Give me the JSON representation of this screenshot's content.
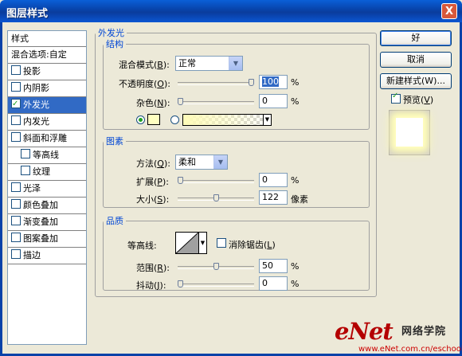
{
  "window": {
    "title": "图层样式",
    "close_glyph": "X"
  },
  "style_list": {
    "header": "样式",
    "items": [
      {
        "label": "混合选项:自定",
        "checkbox": false,
        "checked": false,
        "selected": false,
        "indent": false
      },
      {
        "label": "投影",
        "checkbox": true,
        "checked": false,
        "selected": false,
        "indent": false
      },
      {
        "label": "内阴影",
        "checkbox": true,
        "checked": false,
        "selected": false,
        "indent": false
      },
      {
        "label": "外发光",
        "checkbox": true,
        "checked": true,
        "selected": true,
        "indent": false
      },
      {
        "label": "内发光",
        "checkbox": true,
        "checked": false,
        "selected": false,
        "indent": false
      },
      {
        "label": "斜面和浮雕",
        "checkbox": true,
        "checked": false,
        "selected": false,
        "indent": false
      },
      {
        "label": "等高线",
        "checkbox": true,
        "checked": false,
        "selected": false,
        "indent": true
      },
      {
        "label": "纹理",
        "checkbox": true,
        "checked": false,
        "selected": false,
        "indent": true
      },
      {
        "label": "光泽",
        "checkbox": true,
        "checked": false,
        "selected": false,
        "indent": false
      },
      {
        "label": "颜色叠加",
        "checkbox": true,
        "checked": false,
        "selected": false,
        "indent": false
      },
      {
        "label": "渐变叠加",
        "checkbox": true,
        "checked": false,
        "selected": false,
        "indent": false
      },
      {
        "label": "图案叠加",
        "checkbox": true,
        "checked": false,
        "selected": false,
        "indent": false
      },
      {
        "label": "描边",
        "checkbox": true,
        "checked": false,
        "selected": false,
        "indent": false
      }
    ]
  },
  "outer_glow": {
    "section_title": "外发光",
    "structure": {
      "title": "结构",
      "blend_mode": {
        "label": "混合模式(",
        "key": "B",
        "label_end": "):",
        "value": "正常"
      },
      "opacity": {
        "label": "不透明度(",
        "key": "O",
        "label_end": "):",
        "value": "100",
        "unit": "%",
        "level": 1.0
      },
      "noise": {
        "label": "杂色(",
        "key": "N",
        "label_end": "):",
        "value": "0",
        "unit": "%",
        "level": 0.0
      },
      "color_mode": "solid",
      "swatch_color": "#ffffc0"
    },
    "elements": {
      "title": "图素",
      "technique": {
        "label": "方法(",
        "key": "Q",
        "label_end": "):",
        "value": "柔和"
      },
      "spread": {
        "label": "扩展(",
        "key": "P",
        "label_end": "):",
        "value": "0",
        "unit": "%",
        "level": 0.0
      },
      "size": {
        "label": "大小(",
        "key": "S",
        "label_end": "):",
        "value": "122",
        "unit": "像素",
        "level": 0.5
      }
    },
    "quality": {
      "title": "品质",
      "contour_label": "等高线:",
      "antialias": {
        "label": "消除锯齿(",
        "key": "L",
        "label_end": ")",
        "checked": false
      },
      "range": {
        "label": "范围(",
        "key": "R",
        "label_end": "):",
        "value": "50",
        "unit": "%",
        "level": 0.5
      },
      "jitter": {
        "label": "抖动(",
        "key": "J",
        "label_end": "):",
        "value": "0",
        "unit": "%",
        "level": 0.0
      }
    }
  },
  "buttons": {
    "ok": "好",
    "cancel": "取消",
    "new_style": "新建样式(W)...",
    "preview_label": "预览(",
    "preview_key": "V",
    "preview_label_end": ")",
    "preview_checked": true
  },
  "watermark": {
    "brand": "eNet",
    "cn": "网络学院",
    "url": "www.eNet.com.cn/eschool"
  },
  "colors": {
    "accent": "#0046d5",
    "selection": "#316ac5",
    "titlebar": "#0842a8"
  }
}
